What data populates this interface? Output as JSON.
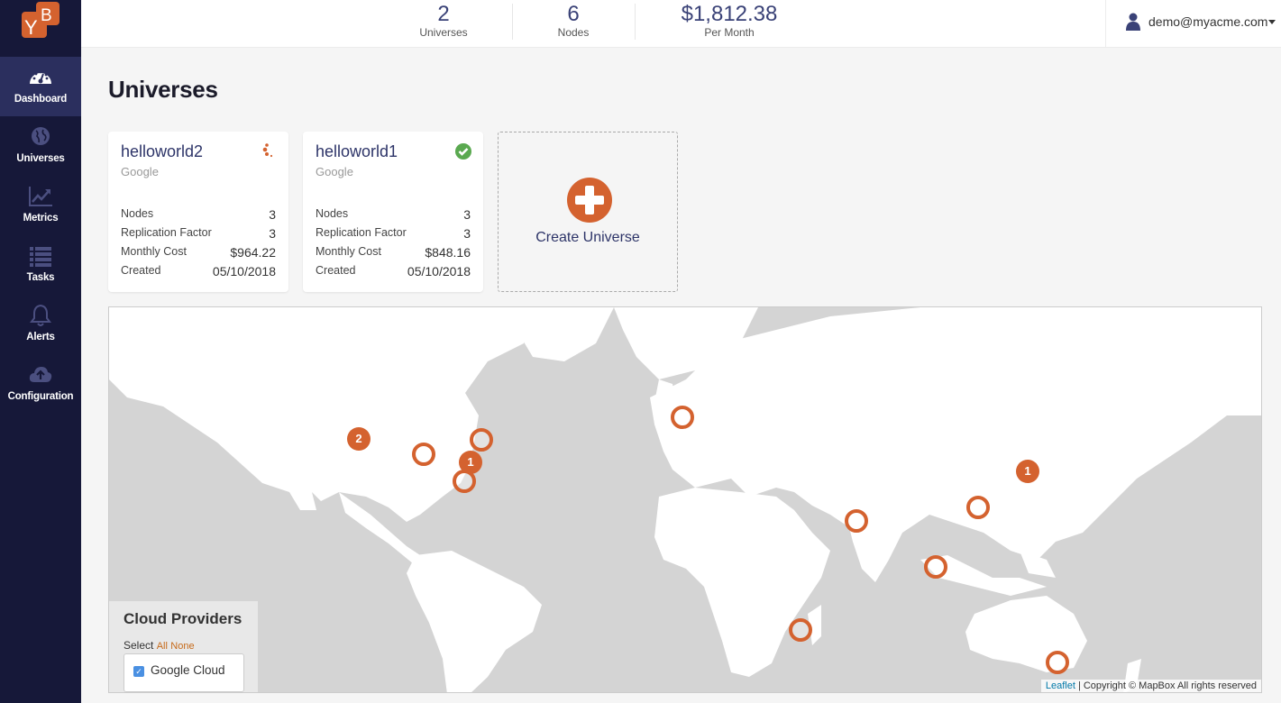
{
  "sidebar": {
    "logo": "YB",
    "items": [
      {
        "label": "Dashboard",
        "icon": "dashboard-gauge-icon",
        "active": true
      },
      {
        "label": "Universes",
        "icon": "globe-icon",
        "active": false
      },
      {
        "label": "Metrics",
        "icon": "line-chart-icon",
        "active": false
      },
      {
        "label": "Tasks",
        "icon": "list-icon",
        "active": false
      },
      {
        "label": "Alerts",
        "icon": "bell-icon",
        "active": false
      },
      {
        "label": "Configuration",
        "icon": "cloud-upload-icon",
        "active": false
      }
    ]
  },
  "header": {
    "stats": [
      {
        "value": "2",
        "caption": "Universes"
      },
      {
        "value": "6",
        "caption": "Nodes"
      },
      {
        "value": "$1,812.38",
        "caption": "Per Month"
      }
    ],
    "user": {
      "email": "demo@myacme.com",
      "icon": "user-icon"
    }
  },
  "page": {
    "title": "Universes"
  },
  "universes": [
    {
      "name": "helloworld2",
      "provider": "Google",
      "status": "in-progress",
      "rows": [
        {
          "label": "Nodes",
          "value": "3"
        },
        {
          "label": "Replication Factor",
          "value": "3"
        },
        {
          "label": "Monthly Cost",
          "value": "$964.22"
        },
        {
          "label": "Created",
          "value": "05/10/2018"
        }
      ]
    },
    {
      "name": "helloworld1",
      "provider": "Google",
      "status": "success",
      "rows": [
        {
          "label": "Nodes",
          "value": "3"
        },
        {
          "label": "Replication Factor",
          "value": "3"
        },
        {
          "label": "Monthly Cost",
          "value": "$848.16"
        },
        {
          "label": "Created",
          "value": "05/10/2018"
        }
      ]
    }
  ],
  "create_universe": {
    "label": "Create Universe"
  },
  "map": {
    "clusters": [
      {
        "count": "2",
        "region": "us-west"
      },
      {
        "count": "1",
        "region": "us-east"
      },
      {
        "count": "1",
        "region": "asia-northeast"
      }
    ],
    "regions": [
      "us-central",
      "us-east-north",
      "us-east-south",
      "europe-west",
      "asia-south",
      "asia-east",
      "asia-southeast",
      "indian-ocean",
      "australia-southeast"
    ],
    "cloud_providers": {
      "title": "Cloud Providers",
      "select_label": "Select",
      "all_label": "All",
      "none_label": "None",
      "options": [
        {
          "label": "Google Cloud",
          "checked": true
        }
      ]
    },
    "attribution": {
      "link": "Leaflet",
      "text": "| Copyright © MapBox All rights reserved"
    }
  },
  "colors": {
    "accent": "#d4622f",
    "sidebar": "#161839",
    "active_nav": "#2b2f5e",
    "success": "#5aa950",
    "title_blue": "#2d3468"
  }
}
